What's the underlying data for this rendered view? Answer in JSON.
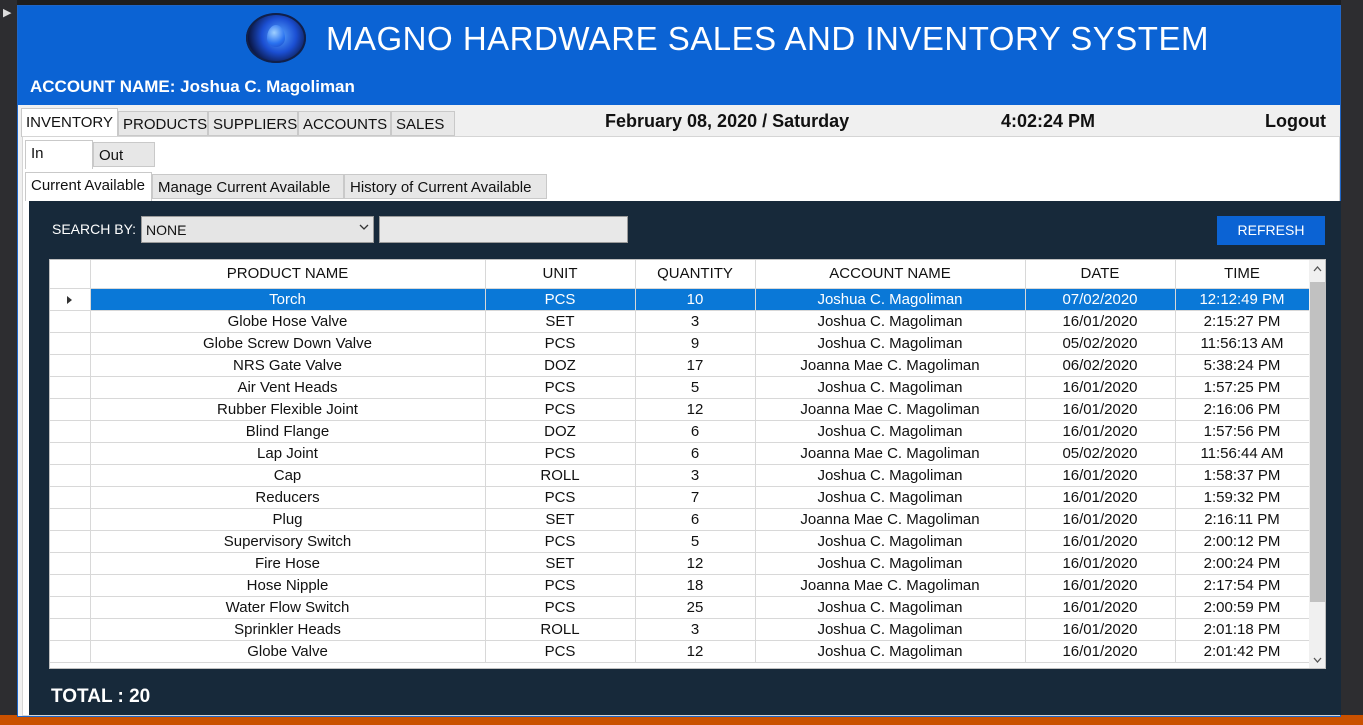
{
  "app": {
    "title": "MAGNO HARDWARE SALES AND INVENTORY SYSTEM",
    "account_label": "ACCOUNT NAME: Joshua C. Magoliman",
    "logo_icon": "blue-drop-logo"
  },
  "nav": {
    "tabs": [
      "INVENTORY",
      "PRODUCTS",
      "SUPPLIERS",
      "ACCOUNTS",
      "SALES"
    ],
    "active": "INVENTORY",
    "date": "February 08, 2020 / Saturday",
    "time": "4:02:24 PM",
    "logout": "Logout"
  },
  "inout_tabs": [
    "In",
    "Out"
  ],
  "sub_tabs": [
    "Current Available",
    "Manage Current Available",
    "History of Current Available"
  ],
  "search": {
    "label": "SEARCH BY:",
    "selected": "NONE",
    "value": "",
    "refresh_label": "REFRESH"
  },
  "table": {
    "columns": [
      "PRODUCT NAME",
      "UNIT",
      "QUANTITY",
      "ACCOUNT NAME",
      "DATE",
      "TIME"
    ],
    "selected_row": 0,
    "rows": [
      [
        "Torch",
        "PCS",
        "10",
        "Joshua C. Magoliman",
        "07/02/2020",
        "12:12:49 PM"
      ],
      [
        "Globe Hose Valve",
        "SET",
        "3",
        "Joshua C. Magoliman",
        "16/01/2020",
        "2:15:27 PM"
      ],
      [
        "Globe Screw Down Valve",
        "PCS",
        "9",
        "Joshua C. Magoliman",
        "05/02/2020",
        "11:56:13 AM"
      ],
      [
        "NRS Gate Valve",
        "DOZ",
        "17",
        "Joanna Mae C. Magoliman",
        "06/02/2020",
        "5:38:24 PM"
      ],
      [
        "Air Vent Heads",
        "PCS",
        "5",
        "Joshua C. Magoliman",
        "16/01/2020",
        "1:57:25 PM"
      ],
      [
        "Rubber Flexible Joint",
        "PCS",
        "12",
        "Joanna Mae C. Magoliman",
        "16/01/2020",
        "2:16:06 PM"
      ],
      [
        "Blind Flange",
        "DOZ",
        "6",
        "Joshua C. Magoliman",
        "16/01/2020",
        "1:57:56 PM"
      ],
      [
        "Lap Joint",
        "PCS",
        "6",
        "Joanna Mae C. Magoliman",
        "05/02/2020",
        "11:56:44 AM"
      ],
      [
        "Cap",
        "ROLL",
        "3",
        "Joshua C. Magoliman",
        "16/01/2020",
        "1:58:37 PM"
      ],
      [
        "Reducers",
        "PCS",
        "7",
        "Joshua C. Magoliman",
        "16/01/2020",
        "1:59:32 PM"
      ],
      [
        "Plug",
        "SET",
        "6",
        "Joanna Mae C. Magoliman",
        "16/01/2020",
        "2:16:11 PM"
      ],
      [
        "Supervisory Switch",
        "PCS",
        "5",
        "Joshua C. Magoliman",
        "16/01/2020",
        "2:00:12 PM"
      ],
      [
        "Fire Hose",
        "SET",
        "12",
        "Joshua C. Magoliman",
        "16/01/2020",
        "2:00:24 PM"
      ],
      [
        "Hose Nipple",
        "PCS",
        "18",
        "Joanna Mae C. Magoliman",
        "16/01/2020",
        "2:17:54 PM"
      ],
      [
        "Water Flow Switch",
        "PCS",
        "25",
        "Joshua C. Magoliman",
        "16/01/2020",
        "2:00:59 PM"
      ],
      [
        "Sprinkler Heads",
        "ROLL",
        "3",
        "Joshua C. Magoliman",
        "16/01/2020",
        "2:01:18 PM"
      ],
      [
        "Globe Valve",
        "PCS",
        "12",
        "Joshua C. Magoliman",
        "16/01/2020",
        "2:01:42 PM"
      ]
    ]
  },
  "total": "TOTAL : 20",
  "colors": {
    "header_blue": "#0b63d4",
    "panel_dark": "#17293a",
    "selection": "#0a78d7"
  }
}
